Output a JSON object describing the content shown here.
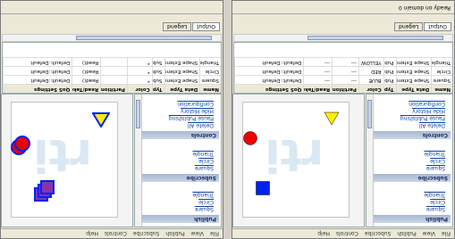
{
  "menu": [
    "File",
    "View",
    "Publish",
    "Subscribe",
    "Controls",
    "Help"
  ],
  "sections": {
    "publish": {
      "title": "Publish",
      "items": [
        "Square",
        "Circle",
        "Triangle"
      ]
    },
    "subscribe": {
      "title": "Subscribe",
      "items": [
        "Square",
        "Circle",
        "Triangle"
      ]
    },
    "controls": {
      "title": "Controls",
      "items": [
        "Delete All",
        "Pause Publishing",
        "Hide History",
        "Configuration"
      ]
    }
  },
  "grid": {
    "headers": [
      "Name",
      "Data Type",
      "Type",
      "Color",
      "Partitions",
      "Read/Take",
      "QoS Settings"
    ],
    "left_rows": [
      [
        "Square",
        "Shape Extended",
        "Pub",
        "BLUE",
        "---",
        "---",
        "Default::Default"
      ],
      [
        "Circle",
        "Shape Extended",
        "Pub",
        "RED",
        "---",
        "---",
        "Default::Default"
      ],
      [
        "Triangle",
        "Shape Extended",
        "Pub",
        "YELLOW",
        "---",
        "---",
        "Default::Default"
      ]
    ],
    "right_rows": [
      [
        "Square",
        "Shape Extended",
        "Sub",
        "*",
        "",
        "Read()",
        "Default::Default"
      ],
      [
        "Circle",
        "Shape Extended",
        "Sub",
        "*",
        "",
        "Read()",
        "Default::Default"
      ],
      [
        "Triangle",
        "Shape Extended",
        "Sub",
        "*",
        "",
        "Read()",
        "Default::Default"
      ]
    ]
  },
  "tabs": [
    "Output",
    "Legend"
  ],
  "status_text": "Ready on domain 0",
  "colors": {
    "blue": "#0022ee",
    "red": "#ee0000",
    "yellow": "#ffee00",
    "purple": "#8833aa"
  }
}
